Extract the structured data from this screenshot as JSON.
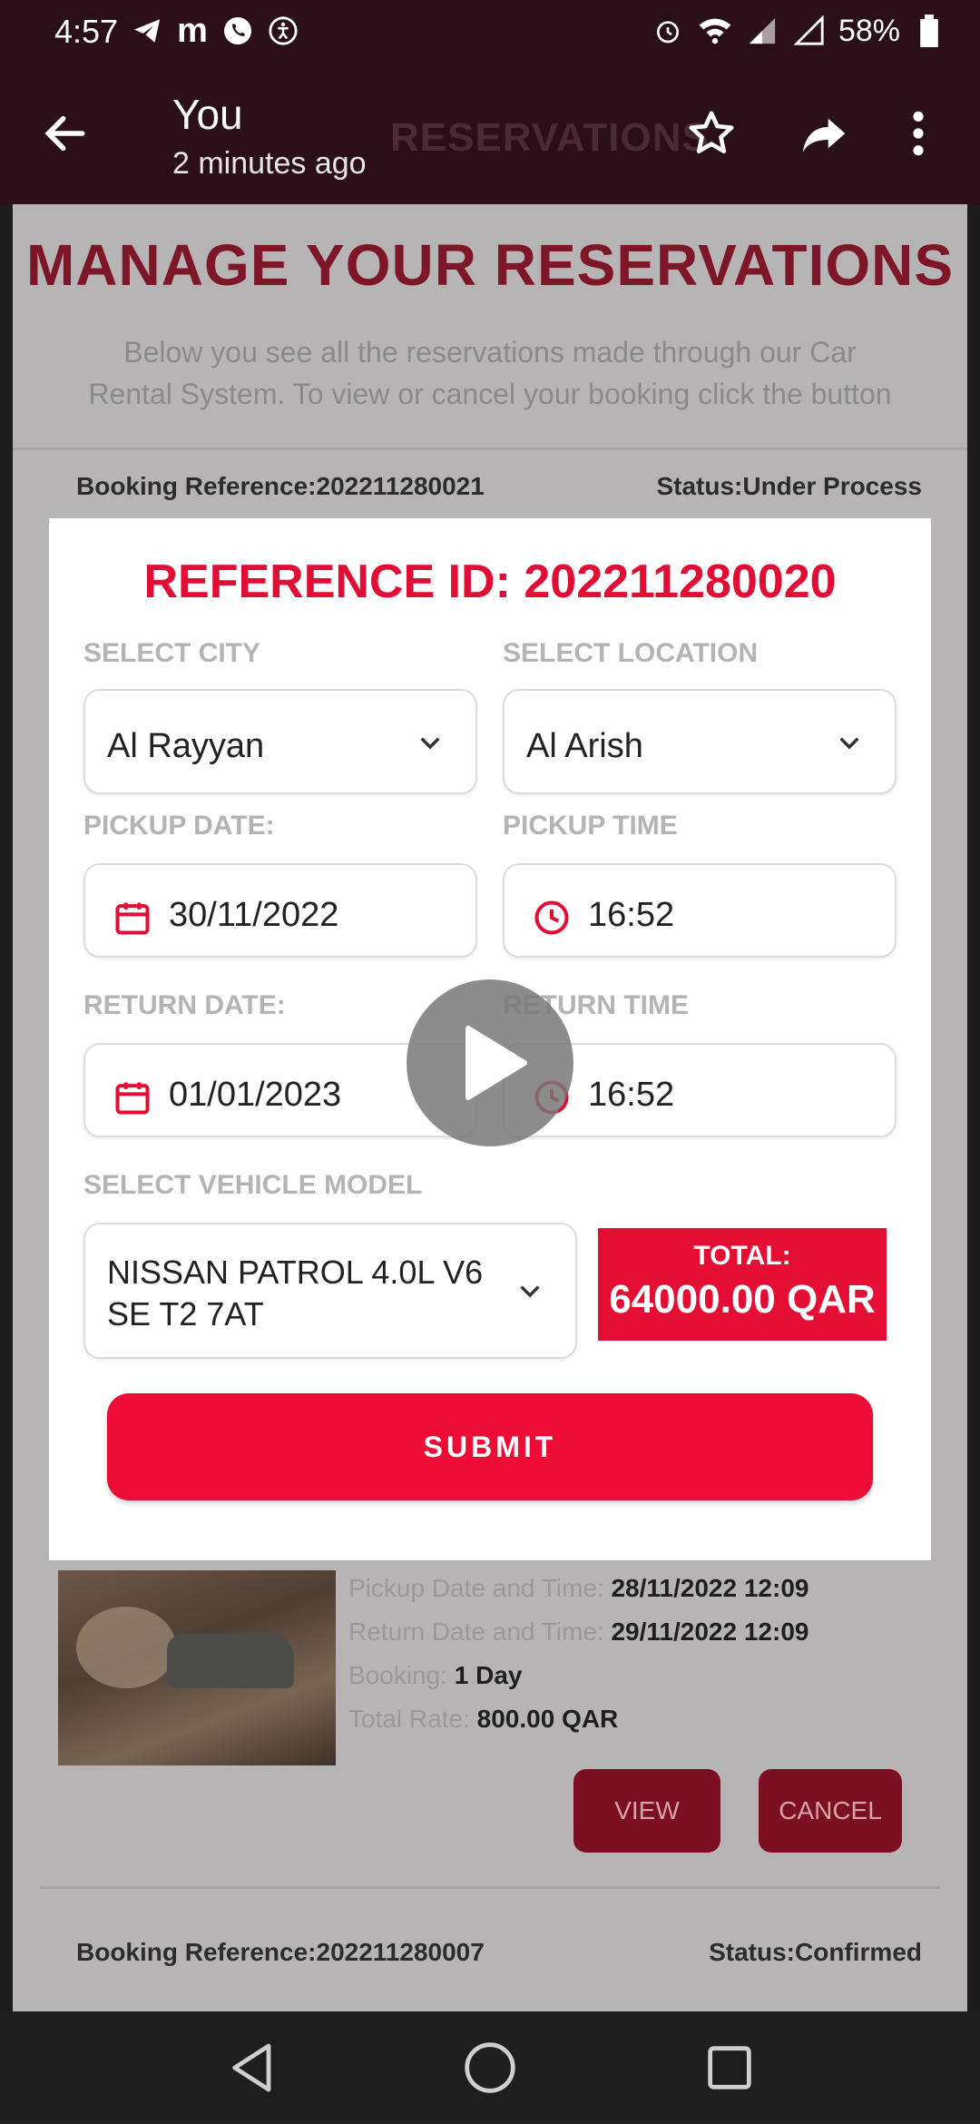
{
  "status_bar": {
    "time": "4:57",
    "battery": "58%"
  },
  "app_bar": {
    "title": "You",
    "subtitle": "2 minutes ago",
    "background_page_title": "RESERVATIONS"
  },
  "page": {
    "heading": "MANAGE YOUR RESERVATIONS",
    "description": "Below you see all the reservations made through our Car Rental System. To view or cancel your booking click the button",
    "booking1": {
      "reference": "Booking Reference:202211280021",
      "status": "Status:Under Process"
    },
    "details": {
      "pickup_label": "Pickup Date and Time:",
      "pickup_value": "28/11/2022 12:09",
      "return_label": "Return Date and Time:",
      "return_value": "29/11/2022 12:09",
      "booking_label": "Booking:",
      "booking_value": "1 Day",
      "rate_label": "Total Rate:",
      "rate_value": "800.00 QAR"
    },
    "view_label": "VIEW",
    "cancel_label": "CANCEL",
    "booking2": {
      "reference": "Booking Reference:202211280007",
      "status": "Status:Confirmed"
    }
  },
  "modal": {
    "reference_id": "REFERENCE ID: 202211280020",
    "city_label": "SELECT CITY",
    "city_value": "Al Rayyan",
    "location_label": "SELECT LOCATION",
    "location_value": "Al Arish",
    "pickup_date_label": "PICKUP DATE:",
    "pickup_date_value": "30/11/2022",
    "pickup_time_label": "PICKUP TIME",
    "pickup_time_value": "16:52",
    "return_date_label": "RETURN DATE:",
    "return_date_value": "01/01/2023",
    "return_time_label": "RETURN TIME",
    "return_time_value": "16:52",
    "vehicle_label": "SELECT VEHICLE MODEL",
    "vehicle_value": "NISSAN PATROL 4.0L V6 SE T2 7AT",
    "total_label": "TOTAL:",
    "total_value": "64000.00 QAR",
    "submit_label": "SUBMIT"
  },
  "colors": {
    "accent": "#e40d33",
    "app_bar": "#2a0e18"
  }
}
